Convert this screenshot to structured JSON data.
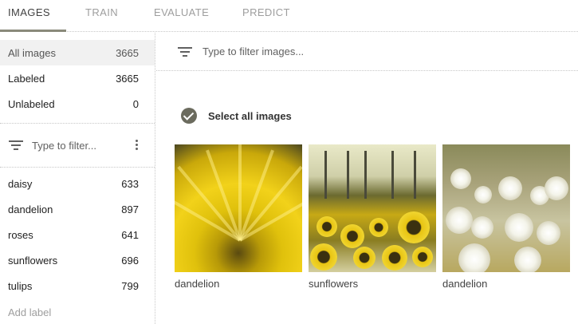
{
  "tabs": [
    {
      "label": "IMAGES",
      "active": true
    },
    {
      "label": "TRAIN",
      "active": false
    },
    {
      "label": "EVALUATE",
      "active": false
    },
    {
      "label": "PREDICT",
      "active": false
    }
  ],
  "sidebar": {
    "summary": [
      {
        "label": "All images",
        "count": "3665",
        "selected": true
      },
      {
        "label": "Labeled",
        "count": "3665",
        "selected": false
      },
      {
        "label": "Unlabeled",
        "count": "0",
        "selected": false
      }
    ],
    "label_filter_placeholder": "Type to filter...",
    "labels": [
      {
        "label": "daisy",
        "count": "633"
      },
      {
        "label": "dandelion",
        "count": "897"
      },
      {
        "label": "roses",
        "count": "641"
      },
      {
        "label": "sunflowers",
        "count": "696"
      },
      {
        "label": "tulips",
        "count": "799"
      }
    ],
    "add_label": "Add label"
  },
  "main": {
    "image_filter_placeholder": "Type to filter images...",
    "select_all_label": "Select all images",
    "images": [
      {
        "caption": "dandelion"
      },
      {
        "caption": "sunflowers"
      },
      {
        "caption": "dandelion"
      }
    ]
  },
  "colors": {
    "accent": "#8a8a7a",
    "check": "#6b6b5e"
  }
}
